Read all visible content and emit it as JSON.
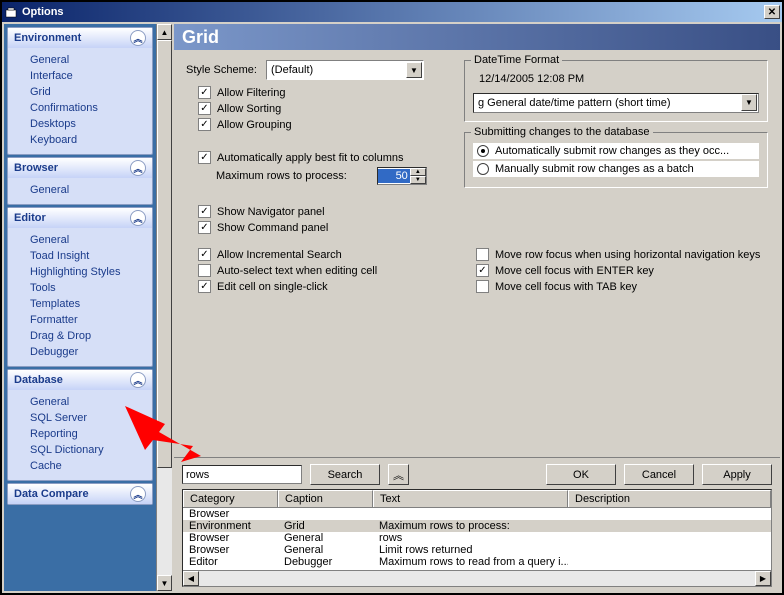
{
  "window": {
    "title": "Options"
  },
  "sidebar": {
    "groups": [
      {
        "title": "Environment",
        "items": [
          "General",
          "Interface",
          "Grid",
          "Confirmations",
          "Desktops",
          "Keyboard"
        ]
      },
      {
        "title": "Browser",
        "items": [
          "General"
        ]
      },
      {
        "title": "Editor",
        "items": [
          "General",
          "Toad Insight",
          "Highlighting Styles",
          "Tools",
          "Templates",
          "Formatter",
          "Drag & Drop",
          "Debugger"
        ]
      },
      {
        "title": "Database",
        "items": [
          "General",
          "SQL Server",
          "Reporting",
          "SQL Dictionary",
          "Cache"
        ]
      },
      {
        "title": "Data Compare",
        "items": []
      }
    ]
  },
  "page": {
    "title": "Grid",
    "styleSchemeLabel": "Style Scheme:",
    "styleSchemeValue": "(Default)",
    "allowFiltering": "Allow Filtering",
    "allowSorting": "Allow Sorting",
    "allowGrouping": "Allow Grouping",
    "autoFit": "Automatically apply best fit to columns",
    "maxRowsLabel": "Maximum rows to process:",
    "maxRowsValue": "50",
    "showNavigator": "Show Navigator panel",
    "showCommand": "Show Command panel",
    "allowIncSearch": "Allow Incremental Search",
    "autoSelectText": "Auto-select text when editing cell",
    "editSingleClick": "Edit cell on single-click",
    "moveRowFocusHoriz": "Move row focus when using horizontal navigation keys",
    "moveCellEnter": "Move cell focus with ENTER key",
    "moveCellTab": "Move cell focus with TAB key"
  },
  "datetime": {
    "groupTitle": "DateTime Format",
    "sample": "12/14/2005 12:08 PM",
    "formatValue": "g General date/time pattern (short time)"
  },
  "submit": {
    "groupTitle": "Submitting changes to the database",
    "auto": "Automatically submit row changes as they occ...",
    "manual": "Manually submit row changes as a batch"
  },
  "search": {
    "value": "rows",
    "button": "Search",
    "collapse": "︽"
  },
  "buttons": {
    "ok": "OK",
    "cancel": "Cancel",
    "apply": "Apply"
  },
  "results": {
    "headers": [
      "Category",
      "Caption",
      "Text",
      "Description"
    ],
    "rows": [
      [
        "Browser",
        "",
        "",
        ""
      ],
      [
        "Environment",
        "Grid",
        "Maximum rows to process:",
        ""
      ],
      [
        "Browser",
        "General",
        "rows",
        ""
      ],
      [
        "Browser",
        "General",
        "Limit rows returned",
        ""
      ],
      [
        "Editor",
        "Debugger",
        "Maximum rows to read from a query i...",
        ""
      ]
    ],
    "selectedIndex": 1
  }
}
